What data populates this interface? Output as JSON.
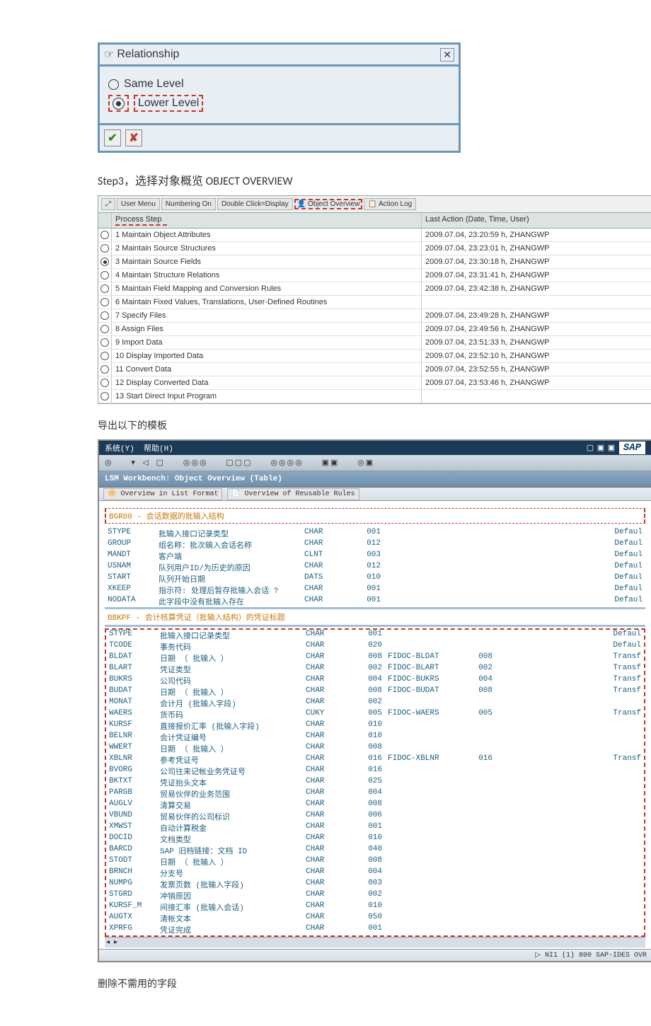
{
  "relationship": {
    "title": "Relationship",
    "opt1": "Same Level",
    "opt2": "Lower Level"
  },
  "step3": "Step3，选择对象概览 OBJECT OVERVIEW",
  "toolbar1": [
    "User Menu",
    "Numbering On",
    "Double Click=Display",
    "Object Overview",
    "Action Log"
  ],
  "ps_head": {
    "step": "Process Step",
    "last": "Last Action (Date, Time, User)"
  },
  "process_steps": [
    {
      "sel": false,
      "label": "1 Maintain Object Attributes",
      "last": "2009.07.04, 23:20:59 h, ZHANGWP"
    },
    {
      "sel": false,
      "label": "2 Maintain Source Structures",
      "last": "2009.07.04, 23:23:01 h, ZHANGWP"
    },
    {
      "sel": true,
      "label": "3 Maintain Source Fields",
      "last": "2009.07.04, 23:30:18 h, ZHANGWP"
    },
    {
      "sel": false,
      "label": "4 Maintain Structure Relations",
      "last": "2009.07.04, 23:31:41 h, ZHANGWP"
    },
    {
      "sel": false,
      "label": "5 Maintain Field Mapping and Conversion Rules",
      "last": "2009.07.04, 23:42:38 h, ZHANGWP"
    },
    {
      "sel": false,
      "label": "6 Maintain Fixed Values, Translations, User-Defined Routines",
      "last": ""
    },
    {
      "sel": false,
      "label": "7 Specify Files",
      "last": "2009.07.04, 23:49:28 h, ZHANGWP"
    },
    {
      "sel": false,
      "label": "8 Assign Files",
      "last": "2009.07.04, 23:49:56 h, ZHANGWP"
    },
    {
      "sel": false,
      "label": "9 Import Data",
      "last": "2009.07.04, 23:51:33 h, ZHANGWP"
    },
    {
      "sel": false,
      "label": "10 Display Imported Data",
      "last": "2009.07.04, 23:52:10 h, ZHANGWP"
    },
    {
      "sel": false,
      "label": "11 Convert Data",
      "last": "2009.07.04, 23:52:55 h, ZHANGWP"
    },
    {
      "sel": false,
      "label": "12 Display Converted Data",
      "last": "2009.07.04, 23:53:46 h, ZHANGWP"
    },
    {
      "sel": false,
      "label": "13 Start Direct Input Program",
      "last": ""
    }
  ],
  "export_txt": "导出以下的模板",
  "sap": {
    "menu_sys": "系统(Y)",
    "menu_help": "帮助(H)",
    "title": "LSM Workbench: Object Overview (Table)",
    "tb1": "Overview in List Format",
    "tb2": "Overview of Reusable Rules",
    "hdr1": "BGR00 - 会话数据的批输入结构",
    "hdr2": "BBKPF - 会计核算凭证（批输入结构）的凭证标题",
    "status": "NI1 (1) 800   SAP-IDES   OVR"
  },
  "group1": [
    {
      "n": "STYPE",
      "d": "批输入接口记录类型",
      "t": "CHAR",
      "l": "001",
      "m": "",
      "x": "",
      "r": "Defaul"
    },
    {
      "n": "GROUP",
      "d": "组名称：批次输入会话名称",
      "t": "CHAR",
      "l": "012",
      "m": "",
      "x": "",
      "r": "Defaul"
    },
    {
      "n": "MANDT",
      "d": "客户端",
      "t": "CLNT",
      "l": "003",
      "m": "",
      "x": "",
      "r": "Defaul"
    },
    {
      "n": "USNAM",
      "d": "队列用户ID/为历史的原因",
      "t": "CHAR",
      "l": "012",
      "m": "",
      "x": "",
      "r": "Defaul"
    },
    {
      "n": "START",
      "d": "队列开始日期",
      "t": "DATS",
      "l": "010",
      "m": "",
      "x": "",
      "r": "Defaul"
    },
    {
      "n": "XKEEP",
      "d": "指示符: 处理后暂存批输入会话 ?",
      "t": "CHAR",
      "l": "001",
      "m": "",
      "x": "",
      "r": "Defaul"
    },
    {
      "n": "NODATA",
      "d": "此字段中没有批输入存在",
      "t": "CHAR",
      "l": "001",
      "m": "",
      "x": "",
      "r": "Defaul"
    }
  ],
  "group2": [
    {
      "n": "STYPE",
      "d": "批输入接口记录类型",
      "t": "CHAR",
      "l": "001",
      "m": "",
      "x": "",
      "r": "Defaul"
    },
    {
      "n": "TCODE",
      "d": "事务代码",
      "t": "CHAR",
      "l": "020",
      "m": "",
      "x": "",
      "r": "Defaul"
    },
    {
      "n": "BLDAT",
      "d": "日期 （ 批输入 ）",
      "t": "CHAR",
      "l": "008",
      "m": "FIDOC-BLDAT",
      "x": "008",
      "r": "Transf"
    },
    {
      "n": "BLART",
      "d": "凭证类型",
      "t": "CHAR",
      "l": "002",
      "m": "FIDOC-BLART",
      "x": "002",
      "r": "Transf"
    },
    {
      "n": "BUKRS",
      "d": "公司代码",
      "t": "CHAR",
      "l": "004",
      "m": "FIDOC-BUKRS",
      "x": "004",
      "r": "Transf"
    },
    {
      "n": "BUDAT",
      "d": "日期 （ 批输入 ）",
      "t": "CHAR",
      "l": "008",
      "m": "FIDOC-BUDAT",
      "x": "008",
      "r": "Transf"
    },
    {
      "n": "MONAT",
      "d": "会计月 (批输入字段)",
      "t": "CHAR",
      "l": "002",
      "m": "",
      "x": "",
      "r": ""
    },
    {
      "n": "WAERS",
      "d": "货币码",
      "t": "CUKY",
      "l": "005",
      "m": "FIDOC-WAERS",
      "x": "005",
      "r": "Transf"
    },
    {
      "n": "KURSF",
      "d": "直接报价汇率 (批输入字段)",
      "t": "CHAR",
      "l": "010",
      "m": "",
      "x": "",
      "r": ""
    },
    {
      "n": "BELNR",
      "d": "会计凭证编号",
      "t": "CHAR",
      "l": "010",
      "m": "",
      "x": "",
      "r": ""
    },
    {
      "n": "WWERT",
      "d": "日期 （ 批输入 ）",
      "t": "CHAR",
      "l": "008",
      "m": "",
      "x": "",
      "r": ""
    },
    {
      "n": "XBLNR",
      "d": "参考凭证号",
      "t": "CHAR",
      "l": "016",
      "m": "FIDOC-XBLNR",
      "x": "016",
      "r": "Transf"
    },
    {
      "n": "BVORG",
      "d": "公司往来记帐业务凭证号",
      "t": "CHAR",
      "l": "016",
      "m": "",
      "x": "",
      "r": ""
    },
    {
      "n": "BKTXT",
      "d": "凭证抬头文本",
      "t": "CHAR",
      "l": "025",
      "m": "",
      "x": "",
      "r": ""
    },
    {
      "n": "PARGB",
      "d": "贸易伙伴的业务范围",
      "t": "CHAR",
      "l": "004",
      "m": "",
      "x": "",
      "r": ""
    },
    {
      "n": "AUGLV",
      "d": "清算交易",
      "t": "CHAR",
      "l": "008",
      "m": "",
      "x": "",
      "r": ""
    },
    {
      "n": "VBUND",
      "d": "贸易伙伴的公司标识",
      "t": "CHAR",
      "l": "006",
      "m": "",
      "x": "",
      "r": ""
    },
    {
      "n": "XMWST",
      "d": "自动计算税金",
      "t": "CHAR",
      "l": "001",
      "m": "",
      "x": "",
      "r": ""
    },
    {
      "n": "DOCID",
      "d": "文档类型",
      "t": "CHAR",
      "l": "010",
      "m": "",
      "x": "",
      "r": ""
    },
    {
      "n": "BARCD",
      "d": "SAP 旧档链接：文档 ID",
      "t": "CHAR",
      "l": "040",
      "m": "",
      "x": "",
      "r": ""
    },
    {
      "n": "STODT",
      "d": "日期 （ 批输入 ）",
      "t": "CHAR",
      "l": "008",
      "m": "",
      "x": "",
      "r": ""
    },
    {
      "n": "BRNCH",
      "d": "分支号",
      "t": "CHAR",
      "l": "004",
      "m": "",
      "x": "",
      "r": ""
    },
    {
      "n": "NUMPG",
      "d": "发票页数 (批输入字段)",
      "t": "CHAR",
      "l": "003",
      "m": "",
      "x": "",
      "r": ""
    },
    {
      "n": "STGRD",
      "d": "冲销原因",
      "t": "CHAR",
      "l": "002",
      "m": "",
      "x": "",
      "r": ""
    },
    {
      "n": "KURSF_M",
      "d": "间接汇率 (批输入会话)",
      "t": "CHAR",
      "l": "010",
      "m": "",
      "x": "",
      "r": ""
    },
    {
      "n": "AUGTX",
      "d": "清帐文本",
      "t": "CHAR",
      "l": "050",
      "m": "",
      "x": "",
      "r": ""
    },
    {
      "n": "XPRFG",
      "d": "凭证完成",
      "t": "CHAR",
      "l": "001",
      "m": "",
      "x": "",
      "r": ""
    }
  ],
  "footer": "删除不需用的字段"
}
